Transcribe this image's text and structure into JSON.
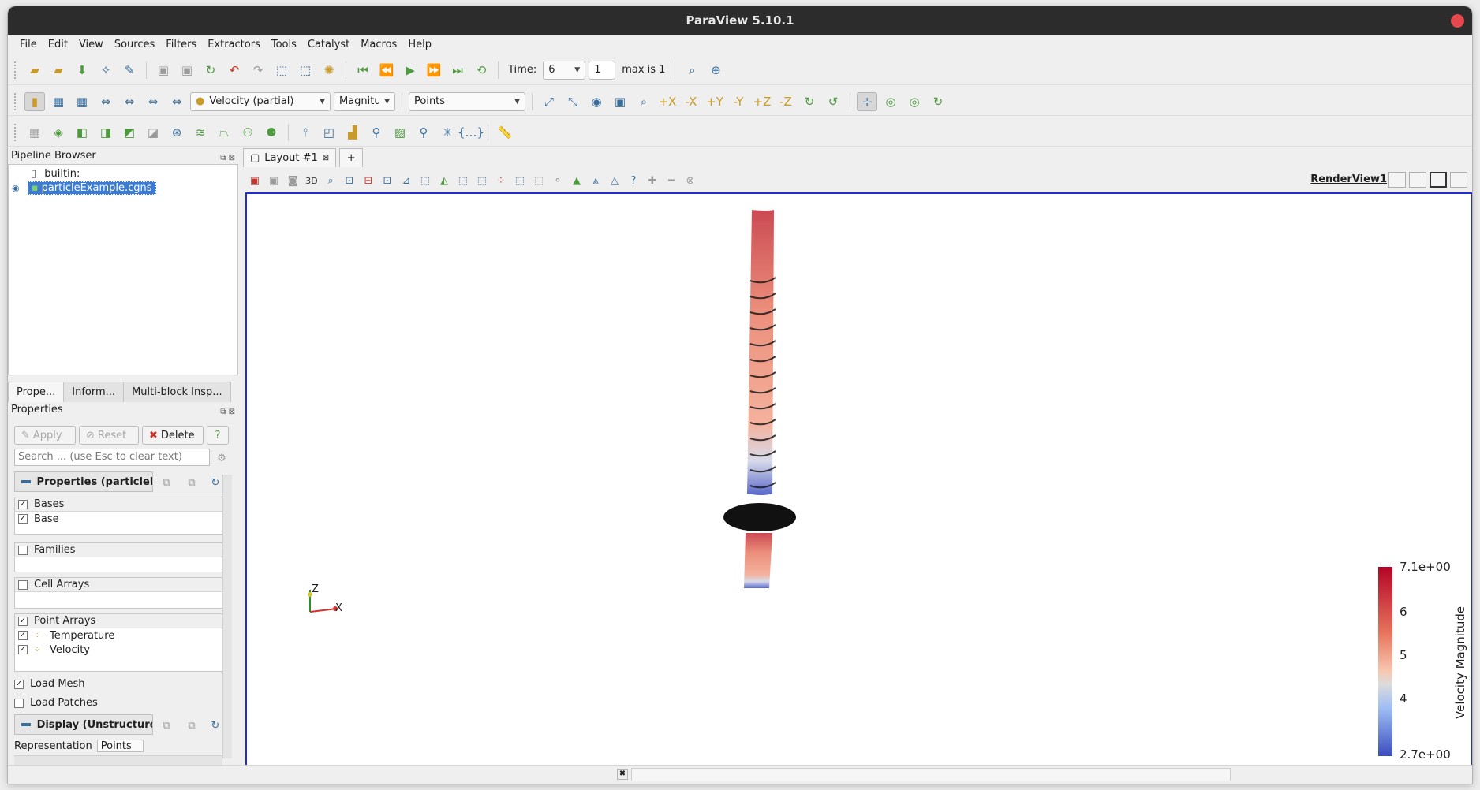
{
  "window": {
    "title": "ParaView 5.10.1"
  },
  "menu": [
    "File",
    "Edit",
    "View",
    "Sources",
    "Filters",
    "Extractors",
    "Tools",
    "Catalyst",
    "Macros",
    "Help"
  ],
  "time_toolbar": {
    "time_label": "Time:",
    "time_value": "6",
    "index_value": "1",
    "max_label": "max is 1"
  },
  "display_toolbar": {
    "color_array": "Velocity (partial)",
    "component": "Magnitude",
    "representation": "Points"
  },
  "pipeline": {
    "title": "Pipeline Browser",
    "items": [
      {
        "label": "builtin:"
      },
      {
        "label": "particleExample.cgns",
        "selected": true
      }
    ]
  },
  "tabs": [
    "Prope...",
    "Inform...",
    "Multi-block Insp..."
  ],
  "properties": {
    "title": "Properties",
    "apply": "Apply",
    "reset": "Reset",
    "delete": "Delete",
    "help": "?",
    "search_placeholder": "Search ... (use Esc to clear text)",
    "section_properties": "Properties (particleE",
    "bases_header": "Bases",
    "bases": [
      "Base"
    ],
    "families_header": "Families",
    "cell_arrays_header": "Cell Arrays",
    "point_arrays_header": "Point Arrays",
    "point_arrays": [
      "Temperature",
      "Velocity"
    ],
    "load_mesh": "Load Mesh",
    "load_patches": "Load Patches",
    "section_display": "Display (Unstructure",
    "representation_label": "Representation",
    "representation_value": "Points"
  },
  "layout": {
    "tab_label": "Layout #1",
    "add_tab": "+",
    "view_name": "RenderView1"
  },
  "render": {
    "axes": {
      "z": "Z",
      "x": "X"
    },
    "colorbar": {
      "title": "Velocity Magnitude",
      "max": "7.1e+00",
      "min": "2.7e+00",
      "ticks": [
        "6",
        "5",
        "4"
      ],
      "colors": {
        "high": "#b40426",
        "mid": "#dddddd",
        "low": "#3b4cc0"
      }
    }
  }
}
